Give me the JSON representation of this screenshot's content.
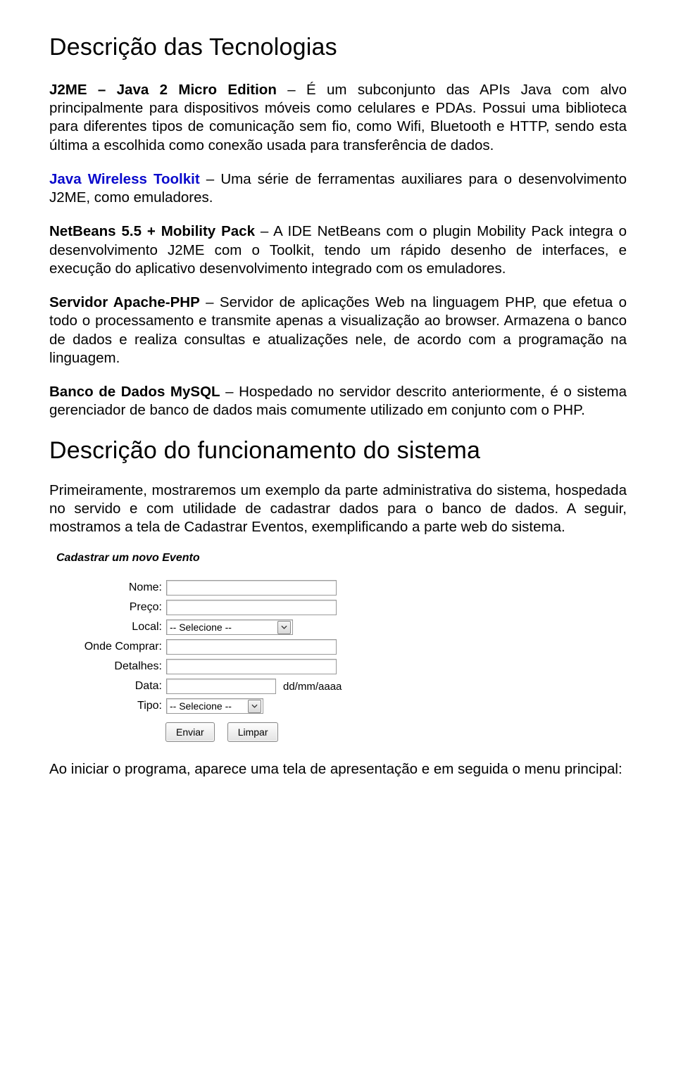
{
  "heading1": "Descrição das Tecnologias",
  "p1a": "J2ME – Java 2 Micro Edition",
  "p1b": " – É um subconjunto das APIs Java com alvo principalmente para dispositivos móveis como celulares e PDAs. Possui uma biblioteca para diferentes tipos de comunicação sem fio, como Wifi, Bluetooth e HTTP, sendo esta última a escolhida como conexão usada para transferência de dados.",
  "p2a": "Java Wireless Toolkit",
  "p2b": " – Uma série de ferramentas auxiliares para o desenvolvimento J2ME, como emuladores.",
  "p3a": "NetBeans 5.5 + Mobility Pack",
  "p3b": " – A IDE NetBeans com o plugin Mobility Pack integra o desenvolvimento J2ME com o Toolkit, tendo um rápido desenho de interfaces, e execução do aplicativo desenvolvimento integrado com os emuladores.",
  "p4a": "Servidor Apache-PHP",
  "p4b": " – Servidor de aplicações Web na linguagem PHP, que efetua o todo o processamento e transmite apenas a visualização ao browser. Armazena o banco de dados e realiza consultas e atualizações nele, de acordo com a programação na linguagem.",
  "p5a": "Banco de Dados MySQL",
  "p5b": " – Hospedado  no servidor descrito anteriormente, é o sistema gerenciador de banco de dados mais comumente utilizado em conjunto com o PHP.",
  "heading2": "Descrição do funcionamento do sistema",
  "p6": "Primeiramente, mostraremos um exemplo da parte administrativa do sistema, hospedada no servido e com utilidade de cadastrar dados para o banco de dados. A seguir, mostramos a tela de Cadastrar Eventos, exemplificando a parte web do sistema.",
  "form": {
    "title": "Cadastrar um novo Evento",
    "labels": {
      "nome": "Nome:",
      "preco": "Preço:",
      "local": "Local:",
      "onde": "Onde Comprar:",
      "detalhes": "Detalhes:",
      "data": "Data:",
      "tipo": "Tipo:"
    },
    "select_placeholder": "-- Selecione --",
    "date_hint": "dd/mm/aaaa",
    "btn_enviar": "Enviar",
    "btn_limpar": "Limpar"
  },
  "p7": "Ao iniciar o programa, aparece uma tela de apresentação e em seguida o menu principal:"
}
